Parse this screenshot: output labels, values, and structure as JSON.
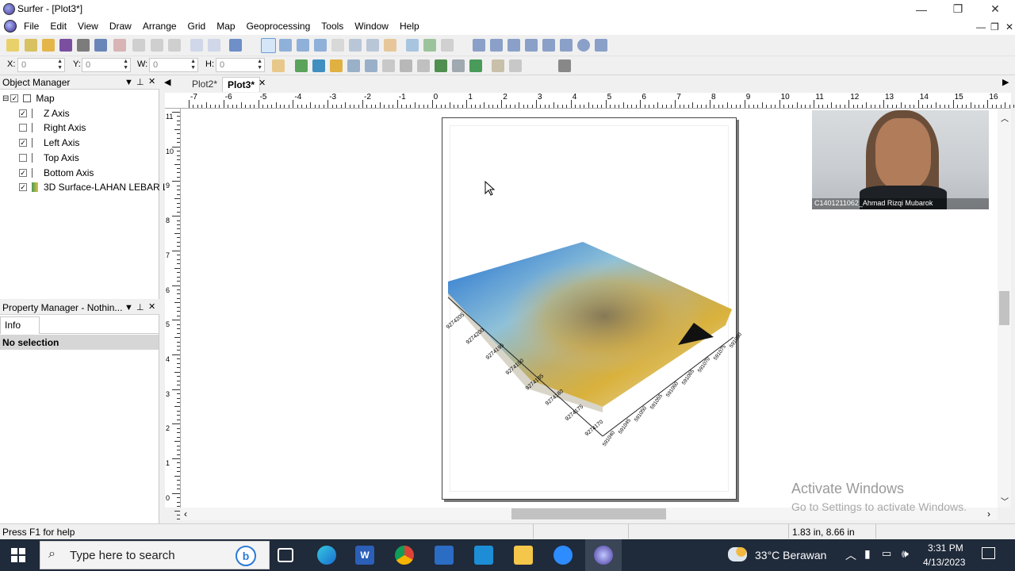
{
  "window": {
    "title": "Surfer - [Plot3*]",
    "minimize": "—",
    "restore": "❐",
    "close": "✕"
  },
  "menu": {
    "items": [
      "File",
      "Edit",
      "View",
      "Draw",
      "Arrange",
      "Grid",
      "Map",
      "Geoprocessing",
      "Tools",
      "Window",
      "Help"
    ],
    "mdi_min": "—",
    "mdi_restore": "❐",
    "mdi_close": "✕"
  },
  "coords": {
    "x_label": "X:",
    "x_value": "0",
    "y_label": "Y:",
    "y_value": "0",
    "w_label": "W:",
    "w_value": "0",
    "h_label": "H:",
    "h_value": "0"
  },
  "object_manager": {
    "title": "Object Manager",
    "items": [
      {
        "label": "Map",
        "checked": true,
        "indent": 0
      },
      {
        "label": "Z Axis",
        "checked": true,
        "indent": 1
      },
      {
        "label": "Right Axis",
        "checked": false,
        "indent": 1
      },
      {
        "label": "Left Axis",
        "checked": true,
        "indent": 1
      },
      {
        "label": "Top Axis",
        "checked": false,
        "indent": 1
      },
      {
        "label": "Bottom Axis",
        "checked": true,
        "indent": 1
      },
      {
        "label": "3D Surface-LAHAN LEBAR L",
        "checked": true,
        "indent": 1
      }
    ]
  },
  "property_manager": {
    "title": "Property Manager - Nothin...",
    "tab": "Info",
    "selection": "No selection"
  },
  "doc_tabs": {
    "tabs": [
      "Plot2*",
      "Plot3*"
    ],
    "active": "Plot3*",
    "close": "✕"
  },
  "ruler": {
    "top_ticks": [
      "-7",
      "-6",
      "-5",
      "-4",
      "-3",
      "-2",
      "-1",
      "0",
      "1",
      "2",
      "3",
      "4",
      "5",
      "6",
      "7",
      "8",
      "9",
      "10",
      "11",
      "12",
      "13",
      "14",
      "15",
      "16"
    ],
    "left_ticks": [
      "11",
      "10",
      "9",
      "8",
      "7",
      "6",
      "5",
      "4",
      "3",
      "2",
      "1",
      "0"
    ]
  },
  "plot": {
    "left_axis_labels": [
      "9274205",
      "9274200",
      "9274195",
      "9274190",
      "9274185",
      "9274180",
      "9274175",
      "9274170"
    ],
    "bottom_axis_labels": [
      "591040",
      "591045",
      "591050",
      "591055",
      "591060",
      "591065",
      "591070",
      "591075",
      "591080"
    ]
  },
  "webcam": {
    "name": "C1401211062_Ahmad Rizqi Mubarok"
  },
  "watermark": {
    "line1": "Activate Windows",
    "line2": "Go to Settings to activate Windows."
  },
  "status": {
    "help": "Press F1 for help",
    "position": "1.83 in, 8.66 in"
  },
  "taskbar": {
    "search_placeholder": "Type here to search",
    "weather": "33°C  Berawan",
    "time": "3:31 PM",
    "date": "4/13/2023"
  }
}
